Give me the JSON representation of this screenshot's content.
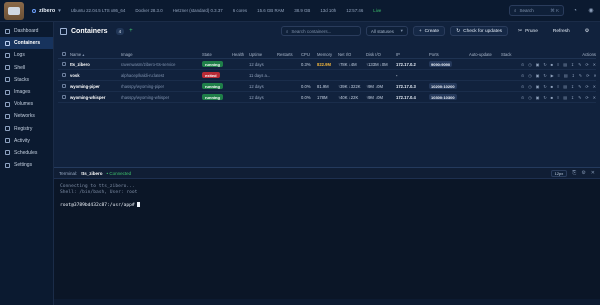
{
  "topbar": {
    "host": "zibero",
    "stats": [
      "Ubuntu 22.04.5 LTS x86_64",
      "Docker 28.3.0",
      "Hetzner (standard) 0.3.37",
      "6 cores",
      "15.6 GB RAM",
      "38.9 GB",
      "13d 10h",
      "12:57:46"
    ],
    "live": "Live",
    "search_placeholder": "Search",
    "search_shortcut": "⌘ K"
  },
  "sidebar": {
    "items": [
      {
        "label": "Dashboard",
        "icon": "grid-icon"
      },
      {
        "label": "Containers",
        "icon": "box-icon"
      },
      {
        "label": "Logs",
        "icon": "file-text-icon"
      },
      {
        "label": "Shell",
        "icon": "terminal-icon"
      },
      {
        "label": "Stacks",
        "icon": "layers-icon"
      },
      {
        "label": "Images",
        "icon": "image-icon"
      },
      {
        "label": "Volumes",
        "icon": "database-icon"
      },
      {
        "label": "Networks",
        "icon": "network-icon"
      },
      {
        "label": "Registry",
        "icon": "package-icon"
      },
      {
        "label": "Activity",
        "icon": "activity-icon"
      },
      {
        "label": "Schedules",
        "icon": "clock-icon"
      },
      {
        "label": "Settings",
        "icon": "gear-icon"
      }
    ],
    "active_index": 1
  },
  "main": {
    "title": "Containers",
    "count": "4",
    "search_placeholder": "Search containers...",
    "filter_value": "All statuses",
    "create_label": "Create",
    "check_updates_label": "Check for updates",
    "prune_label": "Prune",
    "refresh_label": "Refresh"
  },
  "table": {
    "headers": {
      "name": "Name",
      "image": "Image",
      "state": "State",
      "health": "Health",
      "uptime": "Uptime",
      "restarts": "Restarts",
      "cpu": "CPU",
      "memory": "Memory",
      "net": "Net I/O",
      "disk": "Disk I/O",
      "ip": "IP",
      "ports": "Ports",
      "auto_update": "Auto-update",
      "stack": "Stack",
      "actions": "Actions"
    },
    "rows": [
      {
        "name": "tts_zibero",
        "image": "ravenwasm/zibero-tts-service",
        "state": "running",
        "state_color": "#1f7f49",
        "uptime": "12 days",
        "cpu": "0.3%",
        "memory": "822.9M",
        "net": "↑78K ↓4M",
        "disk": "↑133M ↓0M",
        "ip": "172.17.0.2",
        "port": "9090:9090",
        "actions": "⊙ ◷ ▣ ↻ ■ ≡ ▤ ↧ ✎ ⟳ ✕"
      },
      {
        "name": "vosk",
        "image": "alphacep/kaldi-ru:latest",
        "state": "exited",
        "state_color": "#b82a35",
        "uptime": "11 days a...",
        "cpu": "",
        "memory": "",
        "net": "",
        "disk": "",
        "ip": "-",
        "port": "",
        "actions": "⊙ ◷ ▣ ↻ ▶ ≡ ▤ ↧ ✎ ⟳ ✕"
      },
      {
        "name": "wyoming-piper",
        "image": "rhasspy/wyoming-piper",
        "state": "running",
        "state_color": "#1f7f49",
        "uptime": "12 days",
        "cpu": "0.0%",
        "memory": "81.9M",
        "net": "↑39K ↓322K",
        "disk": "↑9M ↓0M",
        "ip": "172.17.0.3",
        "port": "10200:10200",
        "actions": "⊙ ◷ ▣ ↻ ■ ≡ ▤ ↧ ✎ ⟳ ✕"
      },
      {
        "name": "wyoming-whisper",
        "image": "rhasspy/wyoming-whisper",
        "state": "running",
        "state_color": "#1f7f49",
        "uptime": "12 days",
        "cpu": "0.0%",
        "memory": "178M",
        "net": "↑40K ↓22K",
        "disk": "↑9M ↓0M",
        "ip": "172.17.0.4",
        "port": "10300:10300",
        "actions": "⊙ ◷ ▣ ↻ ■ ≡ ▤ ↧ ✎ ⟳ ✕"
      }
    ]
  },
  "terminal": {
    "label": "Terminal:",
    "container": "tts_zibero",
    "status": "• Connected",
    "font_size": "12px",
    "lines": [
      "Connecting to tts_zibero...",
      "Shell: /bin/bash, User: root"
    ],
    "prompt": "root@3789bd432c87:/usr/app#"
  },
  "colors": {
    "accent": "#17335d",
    "running": "#1f7f49",
    "exited": "#b82a35",
    "live": "#3ec46d"
  }
}
